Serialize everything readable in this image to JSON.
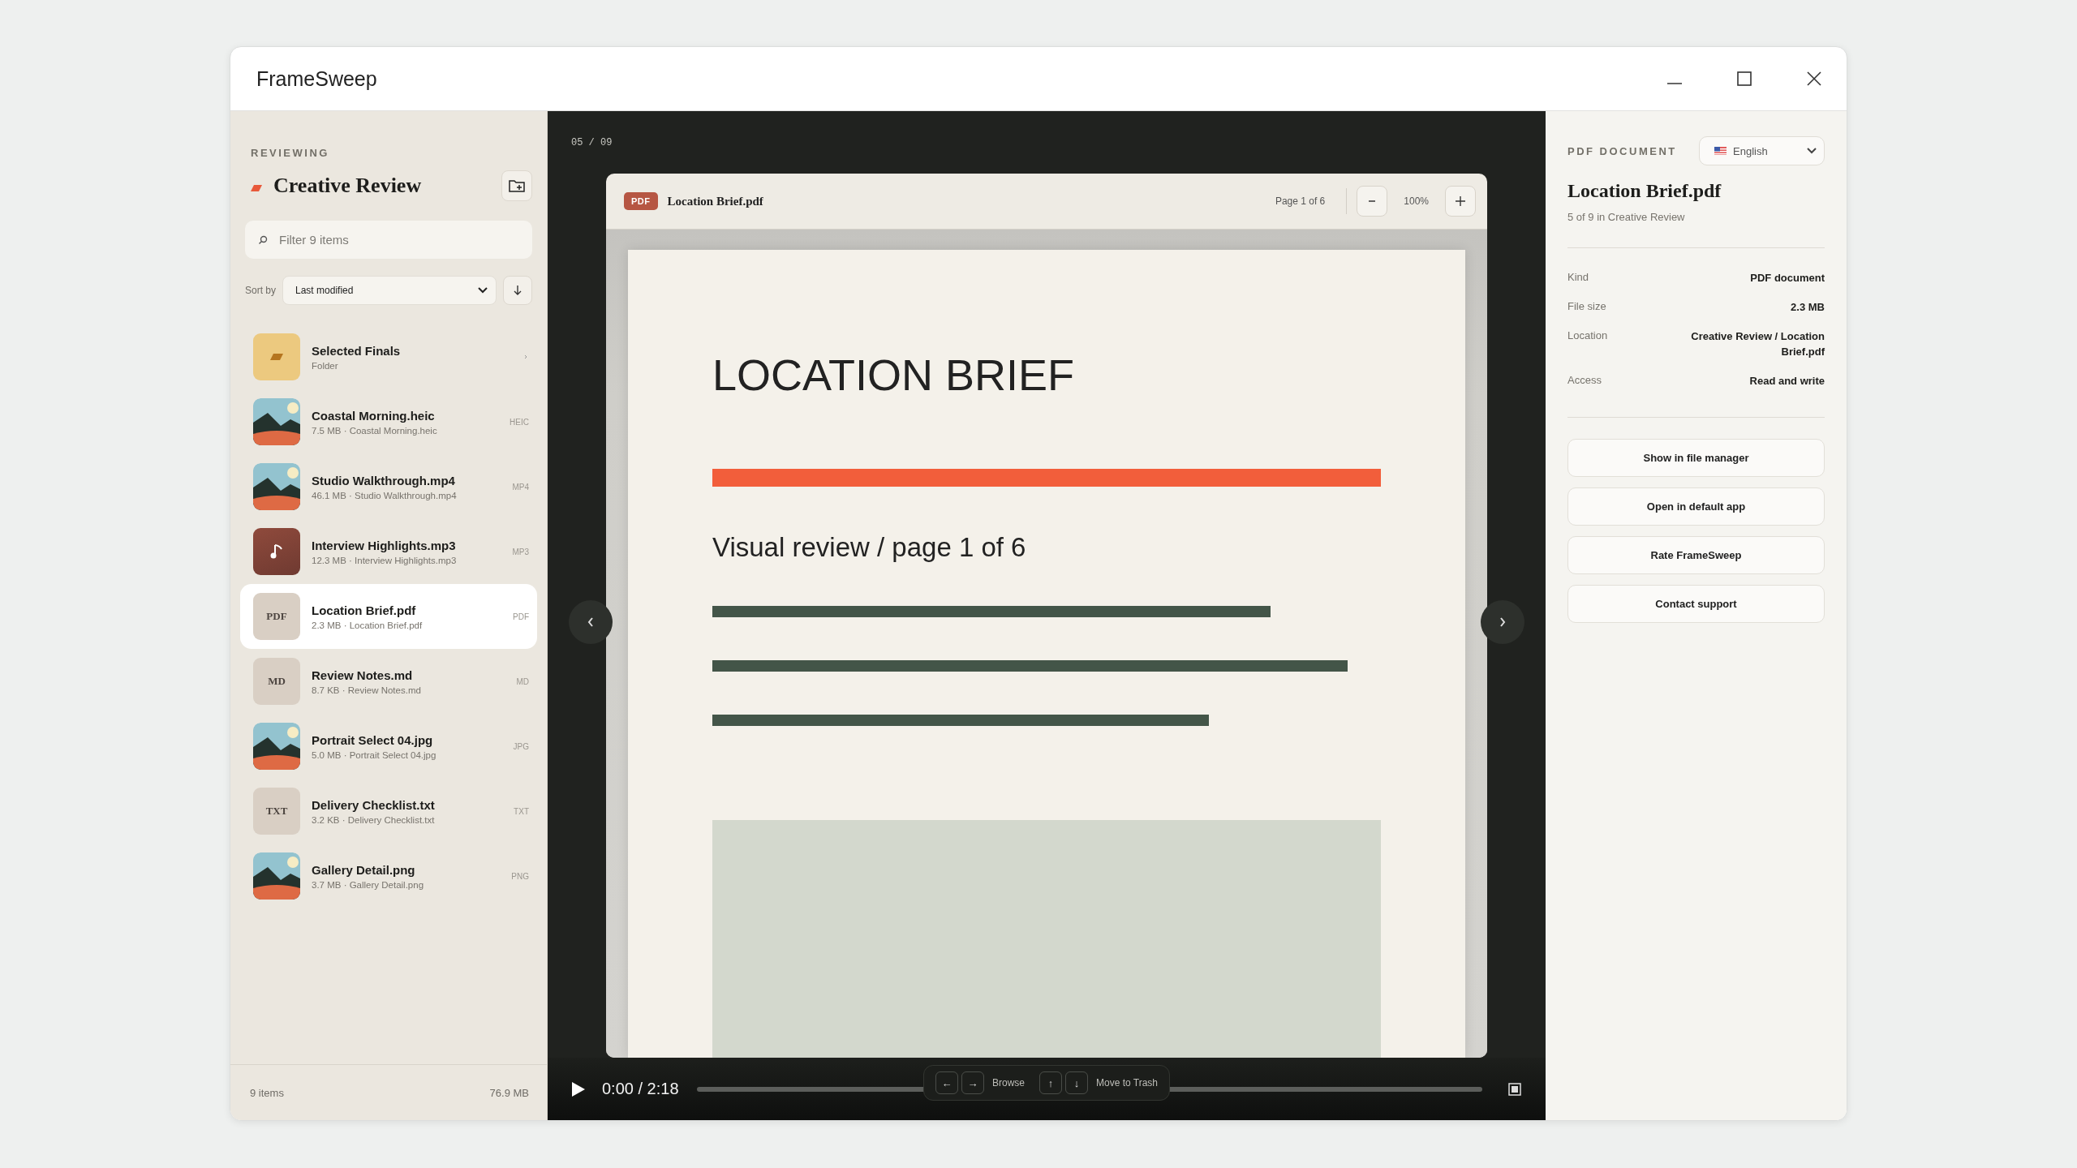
{
  "window": {
    "title": "FrameSweep"
  },
  "sidebar": {
    "eyebrow": "REVIEWING",
    "collection": "Creative Review",
    "filter": {
      "placeholder": "Filter 9 items"
    },
    "sort": {
      "label": "Sort by",
      "value": "Last modified"
    },
    "items": [
      {
        "kind": "folder",
        "name": "Selected Finals",
        "meta": "Folder",
        "selected": false
      },
      {
        "name": "Coastal Morning.heic",
        "meta": "7.5 MB · Coastal Morning.heic",
        "ext": "HEIC",
        "selected": false
      },
      {
        "name": "Studio Walkthrough.mp4",
        "meta": "46.1 MB · Studio Walkthrough.mp4",
        "ext": "MP4",
        "selected": false
      },
      {
        "kind": "audio",
        "name": "Interview Highlights.mp3",
        "meta": "12.3 MB · Interview Highlights.mp3",
        "ext": "MP3",
        "selected": false
      },
      {
        "kind": "document",
        "badge": "PDF",
        "name": "Location Brief.pdf",
        "meta": "2.3 MB · Location Brief.pdf",
        "ext": "PDF",
        "selected": true
      },
      {
        "kind": "document",
        "badge": "MD",
        "name": "Review Notes.md",
        "meta": "8.7 KB · Review Notes.md",
        "ext": "MD",
        "selected": false
      },
      {
        "name": "Portrait Select 04.jpg",
        "meta": "5.0 MB · Portrait Select 04.jpg",
        "ext": "JPG",
        "selected": false
      },
      {
        "kind": "document",
        "badge": "TXT",
        "name": "Delivery Checklist.txt",
        "meta": "3.2 KB · Delivery Checklist.txt",
        "ext": "TXT",
        "selected": false
      },
      {
        "name": "Gallery Detail.png",
        "meta": "3.7 MB · Gallery Detail.png",
        "ext": "PNG",
        "selected": false
      }
    ],
    "footer": {
      "count": "9 items",
      "size": "76.9 MB"
    }
  },
  "viewer": {
    "counter": "05 / 09",
    "document": {
      "badge": "PDF",
      "name": "Location Brief.pdf",
      "page": "Page 1 of 6",
      "zoom": "100%"
    },
    "page": {
      "heading": "LOCATION BRIEF",
      "subheading": "Visual review / page 1 of 6"
    },
    "player": {
      "time": "0:00 / 2:18"
    },
    "hints": [
      {
        "keys": [
          "←",
          "→"
        ],
        "label": "Browse"
      },
      {
        "keys": [
          "↑",
          "↓"
        ],
        "label": "Move to Trash"
      }
    ]
  },
  "details": {
    "eyebrow": "PDF DOCUMENT",
    "language": "English",
    "title": "Location Brief.pdf",
    "subtitle": "5 of 9 in Creative Review",
    "properties": [
      {
        "label": "Kind",
        "value": "PDF document"
      },
      {
        "label": "File size",
        "value": "2.3 MB"
      },
      {
        "label": "Location",
        "value": "Creative Review / Location Brief.pdf"
      },
      {
        "label": "Access",
        "value": "Read and write"
      }
    ],
    "actions": [
      "Show in file manager",
      "Open in default app",
      "Rate FrameSweep",
      "Contact support"
    ]
  }
}
